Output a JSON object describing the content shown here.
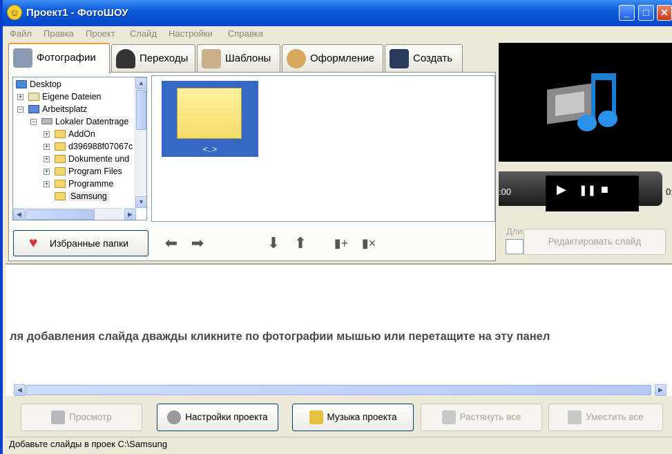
{
  "window": {
    "title": "Проект1 - ФотоШОУ",
    "minimize": "_",
    "maximize": "□",
    "close": "✕"
  },
  "menu": [
    "Файл",
    "Правка",
    "Проект",
    "Слайд",
    "Настройки",
    "Справка"
  ],
  "tabs": [
    {
      "label": "Фотографии",
      "icon": "camera-icon",
      "active": true
    },
    {
      "label": "Переходы",
      "icon": "magic-hat-icon"
    },
    {
      "label": "Шаблоны",
      "icon": "book-icon"
    },
    {
      "label": "Оформление",
      "icon": "palette-icon"
    },
    {
      "label": "Создать",
      "icon": "video-camera-icon"
    }
  ],
  "tree": {
    "nodes": [
      {
        "label": "Desktop",
        "icon": "desktop-icon",
        "expander": ""
      },
      {
        "label": "Eigene Dateien",
        "icon": "documents-icon",
        "expander": "+"
      },
      {
        "label": "Arbeitsplatz",
        "icon": "computer-icon",
        "expander": "−"
      },
      {
        "label": "Lokaler Datentrage",
        "icon": "drive-icon",
        "expander": "−"
      },
      {
        "label": "AddOn",
        "icon": "folder-icon",
        "expander": "+"
      },
      {
        "label": "d396988f07067c",
        "icon": "folder-icon",
        "expander": "+"
      },
      {
        "label": "Dokumente und",
        "icon": "folder-icon",
        "expander": "+"
      },
      {
        "label": "Program Files",
        "icon": "folder-icon",
        "expander": "+"
      },
      {
        "label": "Programme",
        "icon": "folder-icon",
        "expander": "+"
      },
      {
        "label": "Samsung",
        "icon": "folder-open-icon",
        "expander": "",
        "selected": true
      }
    ]
  },
  "photos": {
    "items": [
      {
        "label": "<..>",
        "icon": "folder-icon",
        "selected": true
      }
    ]
  },
  "favorites_button": "Избранные папки",
  "toolbar_icons": [
    "arrow-left-icon",
    "arrow-right-icon",
    "arrow-down-icon",
    "arrow-up-icon",
    "add-slide-icon",
    "remove-slide-icon"
  ],
  "player": {
    "time_left": ":00",
    "time_right": "0:",
    "play": "▶",
    "pause": "❚❚",
    "stop": "■"
  },
  "slide_panel": {
    "duration_label": "Дли",
    "edit_slide": "Редактировать слайд"
  },
  "strip": {
    "hint": "ля добавления слайда дважды кликните по фотографии мышью или перетащите на эту панел"
  },
  "bottom_buttons": [
    {
      "label": "Просмотр",
      "icon": "monitor-icon",
      "enabled": false
    },
    {
      "label": "Настройки проекта",
      "icon": "gear-icon",
      "enabled": true
    },
    {
      "label": "Музыка проекта",
      "icon": "music-folder-icon",
      "enabled": true
    },
    {
      "label": "Растянуть все",
      "icon": "stretch-icon",
      "enabled": false
    },
    {
      "label": "Уместить все",
      "icon": "fit-icon",
      "enabled": false
    }
  ],
  "status": "Добавьте слайды в проек C:\\Samsung",
  "colors": {
    "titlebar": "#0a5bdc",
    "selection": "#3468c4",
    "tab_accent": "#f0a030"
  }
}
